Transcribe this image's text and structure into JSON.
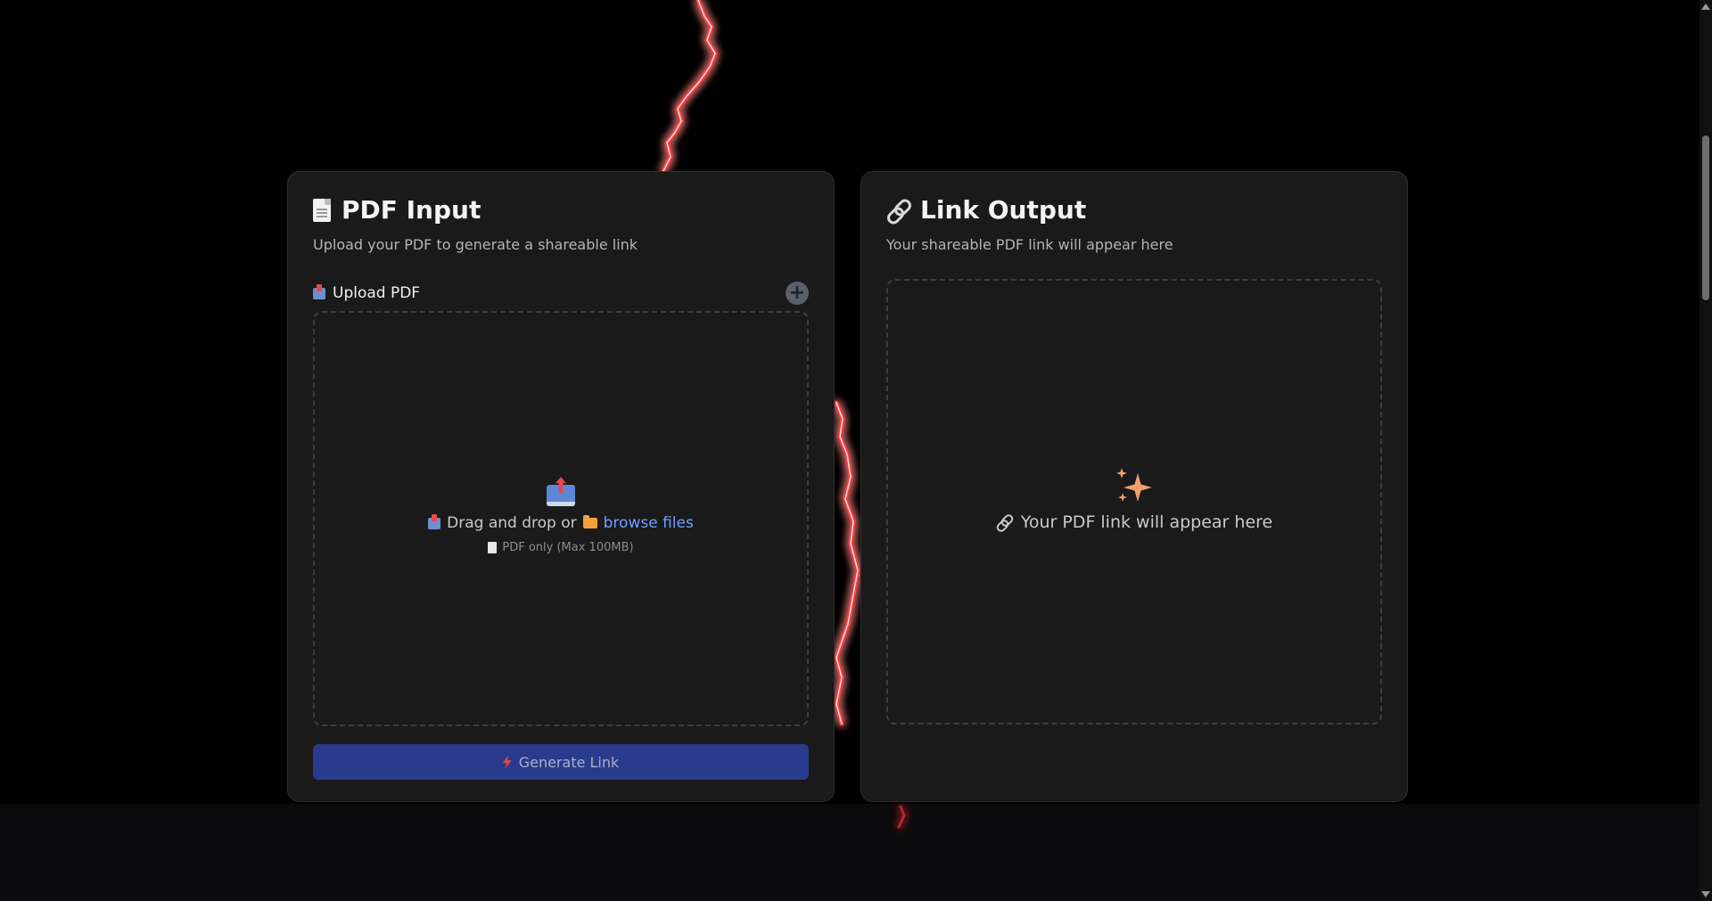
{
  "input_card": {
    "title": "PDF Input",
    "subtitle": "Upload your PDF to generate a shareable link",
    "title_icon": "document-icon",
    "upload_label": "Upload PDF",
    "add_icon": "plus-icon",
    "dropzone": {
      "drag_text": "Drag and drop or",
      "browse_text": "browse files",
      "hint": "PDF only (Max 100MB)"
    },
    "generate_button": "Generate Link"
  },
  "output_card": {
    "title": "Link Output",
    "subtitle": "Your shareable PDF link will appear here",
    "title_icon": "link-icon",
    "placeholder": "Your PDF link will appear here",
    "placeholder_icon": "sparkles-icon"
  },
  "colors": {
    "background": "#000000",
    "card": "#1a1a1b",
    "accent_button": "#2a3a8c",
    "link": "#6fa1ff",
    "sparkle": "#f5a06a",
    "lightning": "#ff3b3b"
  }
}
